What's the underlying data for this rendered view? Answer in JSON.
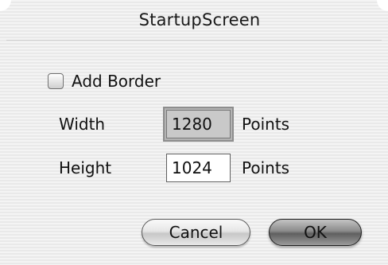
{
  "window": {
    "title": "StartupScreen"
  },
  "options": {
    "add_border_label": "Add Border",
    "add_border_checked": false
  },
  "fields": {
    "width_label": "Width",
    "width_value": "1280",
    "width_unit": "Points",
    "height_label": "Height",
    "height_value": "1024",
    "height_unit": "Points"
  },
  "buttons": {
    "cancel_label": "Cancel",
    "ok_label": "OK"
  }
}
